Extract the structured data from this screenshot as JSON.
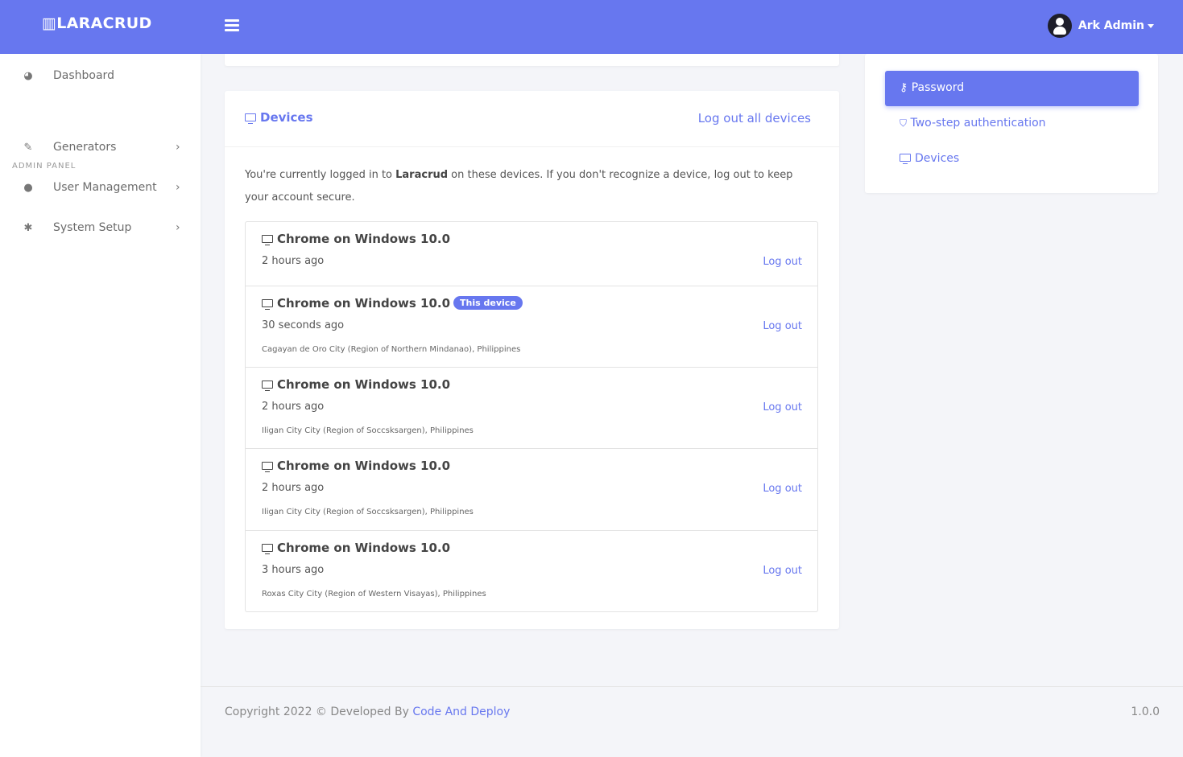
{
  "navbar": {
    "brand": "LARACRUD",
    "user": "Ark Admin"
  },
  "sidebar": {
    "section": "ADMIN PANEL",
    "items": [
      {
        "label": "Dashboard"
      },
      {
        "label": "Generators"
      },
      {
        "label": "User Management"
      },
      {
        "label": "System Setup"
      }
    ]
  },
  "devices": {
    "title": "Devices",
    "logout_all": "Log out all devices",
    "intro_pre": "You're currently logged in to ",
    "intro_app": "Laracrud",
    "intro_post": " on these devices. If you don't recognize a device, log out to keep your account secure.",
    "rows": [
      {
        "name": "Chrome on Windows 10.0",
        "time": "2 hours ago",
        "location": "",
        "action": "Log out"
      },
      {
        "name": "Chrome on Windows 10.0",
        "badge": "This device",
        "time": "30 seconds ago",
        "location": "Cagayan de Oro City (Region of Northern Mindanao), Philippines",
        "action": "Log out"
      },
      {
        "name": "Chrome on Windows 10.0",
        "time": "2 hours ago",
        "location": "Iligan City City (Region of Soccsksargen), Philippines",
        "action": "Log out"
      },
      {
        "name": "Chrome on Windows 10.0",
        "time": "2 hours ago",
        "location": "Iligan City City (Region of Soccsksargen), Philippines",
        "action": "Log out"
      },
      {
        "name": "Chrome on Windows 10.0",
        "time": "3 hours ago",
        "location": "Roxas City City (Region of Western Visayas), Philippines",
        "action": "Log out"
      }
    ]
  },
  "settings_nav": {
    "items": [
      {
        "label": "Password"
      },
      {
        "label": "Two-step authentication"
      },
      {
        "label": "Devices"
      }
    ]
  },
  "footer": {
    "copyright": "Copyright 2022 © Developed By ",
    "link": "Code And Deploy",
    "version": "1.0.0"
  },
  "colors": {
    "accent": "#6777ef"
  }
}
